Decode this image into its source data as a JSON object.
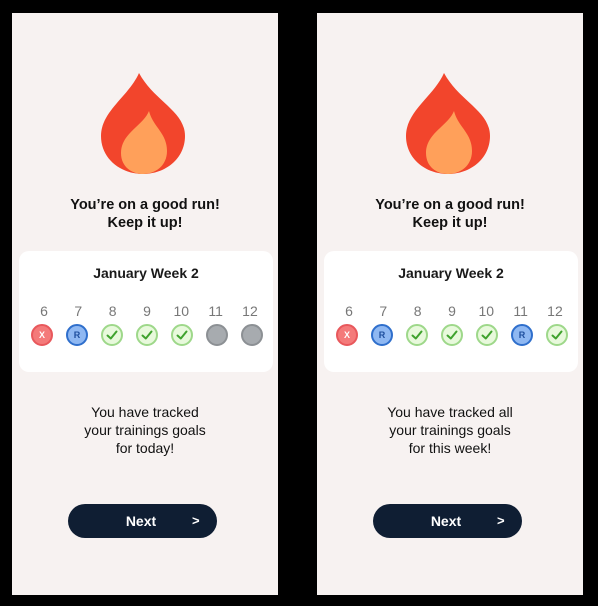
{
  "screens": [
    {
      "headline": [
        "You’re on a good run!",
        "Keep it up!"
      ],
      "week_title": "January Week 2",
      "days": [
        {
          "num": "6",
          "status": "missed",
          "mark": "X"
        },
        {
          "num": "7",
          "status": "rest",
          "mark": "R"
        },
        {
          "num": "8",
          "status": "done",
          "mark": ""
        },
        {
          "num": "9",
          "status": "done",
          "mark": ""
        },
        {
          "num": "10",
          "status": "done",
          "mark": ""
        },
        {
          "num": "11",
          "status": "pending",
          "mark": ""
        },
        {
          "num": "12",
          "status": "pending",
          "mark": ""
        }
      ],
      "message": [
        "You have tracked",
        "your trainings goals",
        "for today!"
      ],
      "next_label": "Next",
      "next_arrow": ">"
    },
    {
      "headline": [
        "You’re on a good run!",
        "Keep it up!"
      ],
      "week_title": "January Week 2",
      "days": [
        {
          "num": "6",
          "status": "missed",
          "mark": "X"
        },
        {
          "num": "7",
          "status": "rest",
          "mark": "R"
        },
        {
          "num": "8",
          "status": "done",
          "mark": ""
        },
        {
          "num": "9",
          "status": "done",
          "mark": ""
        },
        {
          "num": "10",
          "status": "done",
          "mark": ""
        },
        {
          "num": "11",
          "status": "rest",
          "mark": "R"
        },
        {
          "num": "12",
          "status": "done",
          "mark": ""
        }
      ],
      "message": [
        "You have tracked all",
        "your trainings goals",
        "for this week!"
      ],
      "next_label": "Next",
      "next_arrow": ">"
    }
  ],
  "icons": {
    "flame": "fire-icon",
    "check": "check-icon"
  },
  "colors": {
    "flame_outer": "#f2452c",
    "flame_inner": "#ffa05a",
    "button_bg": "#0f1e33",
    "screen_bg": "#f7f2f1",
    "missed": "#f47a7a",
    "rest": "#8fb8f2",
    "done": "#e8f9dc",
    "pending": "#a7abaf"
  }
}
